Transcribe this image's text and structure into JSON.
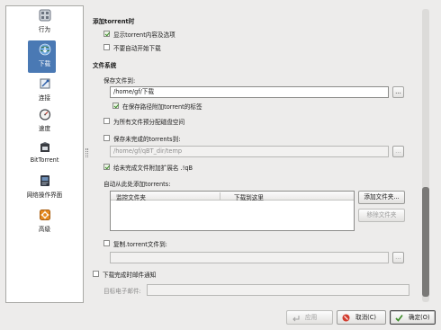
{
  "sidebar": {
    "items": [
      {
        "label": "行为",
        "icon": "behavior-icon"
      },
      {
        "label": "下载",
        "icon": "download-globe-icon",
        "selected": true
      },
      {
        "label": "连接",
        "icon": "connection-icon"
      },
      {
        "label": "速度",
        "icon": "speed-gauge-icon"
      },
      {
        "label": "BitTorrent",
        "icon": "bittorrent-icon"
      },
      {
        "label": "网络操作界面",
        "icon": "web-ui-icon"
      },
      {
        "label": "高级",
        "icon": "advanced-icon"
      }
    ]
  },
  "add_torrent": {
    "heading": "添加torrent时",
    "show_contents": {
      "label": "显示torrent内容及选项",
      "checked": true
    },
    "no_autostart": {
      "label": "不要自动开始下载",
      "checked": false
    }
  },
  "filesystem": {
    "heading": "文件系统",
    "save_to_label": "保存文件到:",
    "save_path": "/home/gf/下载",
    "append_label": {
      "label": "在保存路径附加torrent的标签",
      "checked": true
    },
    "preallocate": {
      "label": "为所有文件预分配磁盘空间",
      "checked": false
    },
    "incomplete": {
      "label": "保存未完成的torrents到:",
      "checked": false,
      "path": "/home/gf/qBT_dir/temp"
    },
    "append_qb": {
      "label": "给未完成文件附加扩展名 .!qB",
      "checked": true
    },
    "auto_add_label": "自动从此处添加torrents:",
    "watch_table": {
      "col1": "监控文件夹",
      "col2": "下载到这里"
    },
    "add_folder_button": "添加文件夹...",
    "remove_folder_button": "移除文件夹",
    "copy_torrent": {
      "label": "复制.torrent文件到:",
      "checked": false
    }
  },
  "email": {
    "notify": {
      "label": "下载完成时邮件通知",
      "checked": false
    },
    "address_label": "目标电子邮件:"
  },
  "browse_label": "...",
  "footer": {
    "apply": "应用",
    "cancel": "取消(C)",
    "ok": "确定(O)"
  },
  "colors": {
    "selection": "#4a79b4",
    "check": "#3a8a27"
  }
}
